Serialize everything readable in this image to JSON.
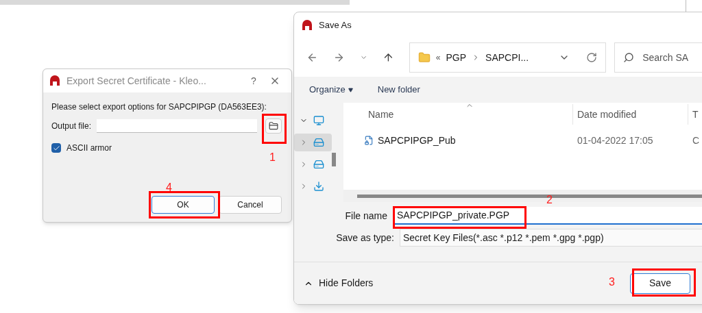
{
  "export_dialog": {
    "title": "Export Secret Certificate - Kleo...",
    "help": "?",
    "prompt": "Please select export options for SAPCPIPGP (DA563EE3):",
    "output_file_label": "Output file:",
    "ascii_armor": {
      "label": "ASCII armor",
      "checked": true
    },
    "buttons": [
      {
        "label": "OK",
        "default": true
      },
      {
        "label": "Cancel",
        "default": false
      }
    ]
  },
  "save_dialog": {
    "title": "Save As",
    "breadcrumb_prefix": "«",
    "breadcrumb": [
      "PGP",
      "SAPCPI..."
    ],
    "search_placeholder": "Search SA",
    "toolbar": [
      "Organize",
      "New folder"
    ],
    "nav_tree": [
      {
        "expanded": true,
        "selected": false
      },
      {
        "expanded": false,
        "selected": true
      },
      {
        "expanded": false,
        "selected": false
      },
      {
        "expanded": false,
        "selected": false
      }
    ],
    "columns": [
      "Name",
      "Date modified",
      "T"
    ],
    "rows": [
      {
        "name": "SAPCPIPGP_Pub",
        "date": "01-04-2022 17:05",
        "type": "C"
      }
    ],
    "file_name": {
      "label": "File name",
      "value": "SAPCPIPGP_private.PGP"
    },
    "save_type": {
      "label": "Save as type:",
      "value": "Secret Key Files(*.asc *.p12 *.pem *.gpg *.pgp)"
    },
    "hide_folders": "Hide Folders",
    "save_button": "Save"
  },
  "annotations": [
    {
      "label": "1"
    },
    {
      "label": "2"
    },
    {
      "label": "3"
    },
    {
      "label": "4"
    }
  ]
}
